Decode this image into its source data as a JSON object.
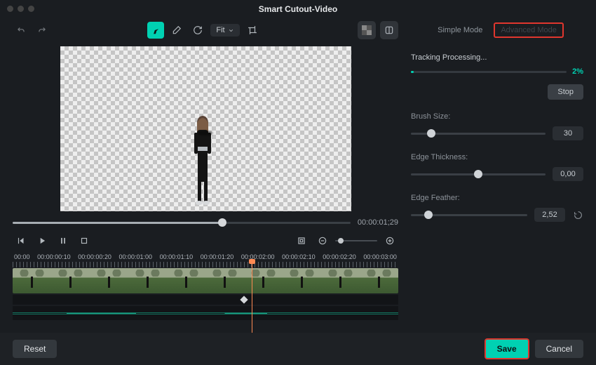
{
  "title": "Smart Cutout-Video",
  "toolbar": {
    "fit_label": "Fit"
  },
  "playback": {
    "current_time": "00:00:01;29",
    "progress_pct": 62
  },
  "ruler": [
    "00:00",
    "00:00:00:10",
    "00:00:00:20",
    "00:00:01:00",
    "00:00:01:10",
    "00:00:01:20",
    "00:00:02:00",
    "00:00:02:10",
    "00:00:02:20",
    "00:00:03:00"
  ],
  "playhead_pct": 62,
  "keyframe_pct": 60,
  "modes": {
    "simple": "Simple Mode",
    "advanced": "Advanced Mode"
  },
  "processing": {
    "label": "Tracking Processing...",
    "pct_text": "2%",
    "pct_num": 2,
    "stop_label": "Stop"
  },
  "params": {
    "brush": {
      "label": "Brush Size:",
      "value": "30",
      "pos": 15
    },
    "edge_thick": {
      "label": "Edge Thickness:",
      "value": "0,00",
      "pos": 50
    },
    "edge_feather": {
      "label": "Edge Feather:",
      "value": "2,52",
      "pos": 15
    }
  },
  "footer": {
    "reset": "Reset",
    "save": "Save",
    "cancel": "Cancel"
  }
}
